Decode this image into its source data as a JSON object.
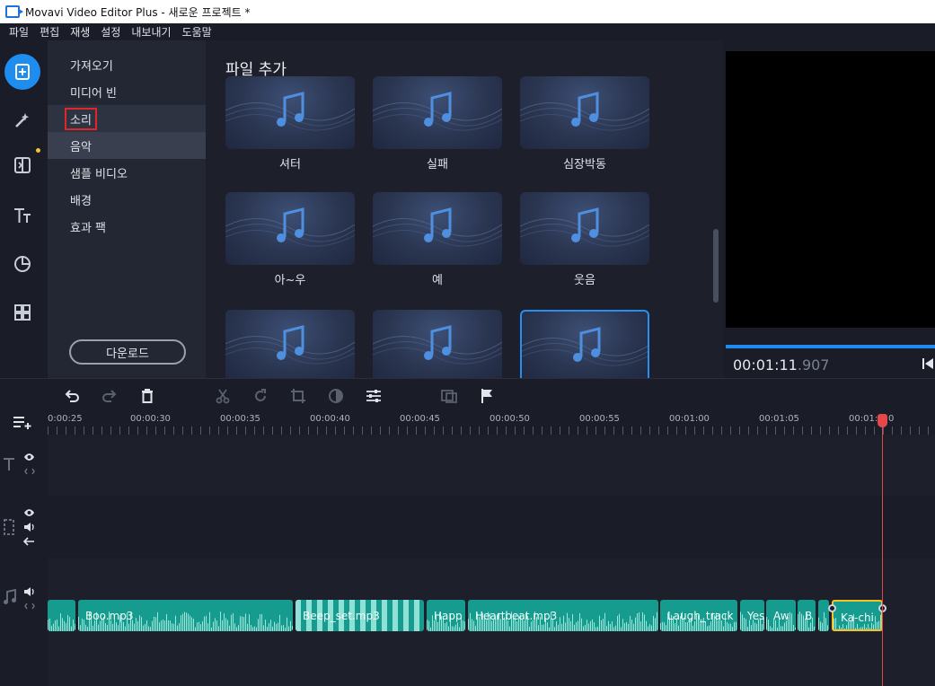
{
  "window": {
    "title": "Movavi Video Editor Plus - 새로운 프로젝트 *"
  },
  "menu": [
    "파일",
    "편집",
    "재생",
    "설정",
    "내보내기",
    "도움말"
  ],
  "rail": [
    {
      "icon": "import-icon",
      "active": true
    },
    {
      "icon": "magic-wand-icon"
    },
    {
      "icon": "transitions-icon",
      "badge": true
    },
    {
      "icon": "titles-icon"
    },
    {
      "icon": "stickers-icon"
    },
    {
      "icon": "more-tools-icon"
    }
  ],
  "categories": {
    "items": [
      "가져오기",
      "미디어 빈",
      "소리",
      "음악",
      "샘플 비디오",
      "배경",
      "효과 팩"
    ],
    "selected": "소리",
    "download_label": "다운로드"
  },
  "content": {
    "title": "파일 추가",
    "tiles": [
      {
        "label": "셔터"
      },
      {
        "label": "실패"
      },
      {
        "label": "심장박동"
      },
      {
        "label": "아~우"
      },
      {
        "label": "예"
      },
      {
        "label": "웃음"
      },
      {
        "label": ""
      },
      {
        "label": ""
      },
      {
        "label": ""
      }
    ]
  },
  "preview": {
    "timecode_main": "00:01:11",
    "timecode_ms": ".907"
  },
  "timeline": {
    "ruler_labels": [
      "0:00:25",
      "00:00:30",
      "00:00:35",
      "00:00:40",
      "00:00:45",
      "00:00:50",
      "00:00:55",
      "00:01:00",
      "00:01:05",
      "00:01:0"
    ],
    "ruler_last_suffix": "0",
    "clips": [
      {
        "name": ""
      },
      {
        "name": "Boo.mp3"
      },
      {
        "name": "Beep_set.mp3"
      },
      {
        "name": "Happ"
      },
      {
        "name": "Heartbeat.mp3"
      },
      {
        "name": "Laugh_track"
      },
      {
        "name": "Yes"
      },
      {
        "name": "Aw"
      },
      {
        "name": "B"
      },
      {
        "name": ""
      },
      {
        "name": "Ka-chi"
      }
    ]
  },
  "colors": {
    "accent": "#1f8df0",
    "clip": "#159c8e",
    "selection": "#f4c228",
    "playhead": "#e6484a"
  }
}
